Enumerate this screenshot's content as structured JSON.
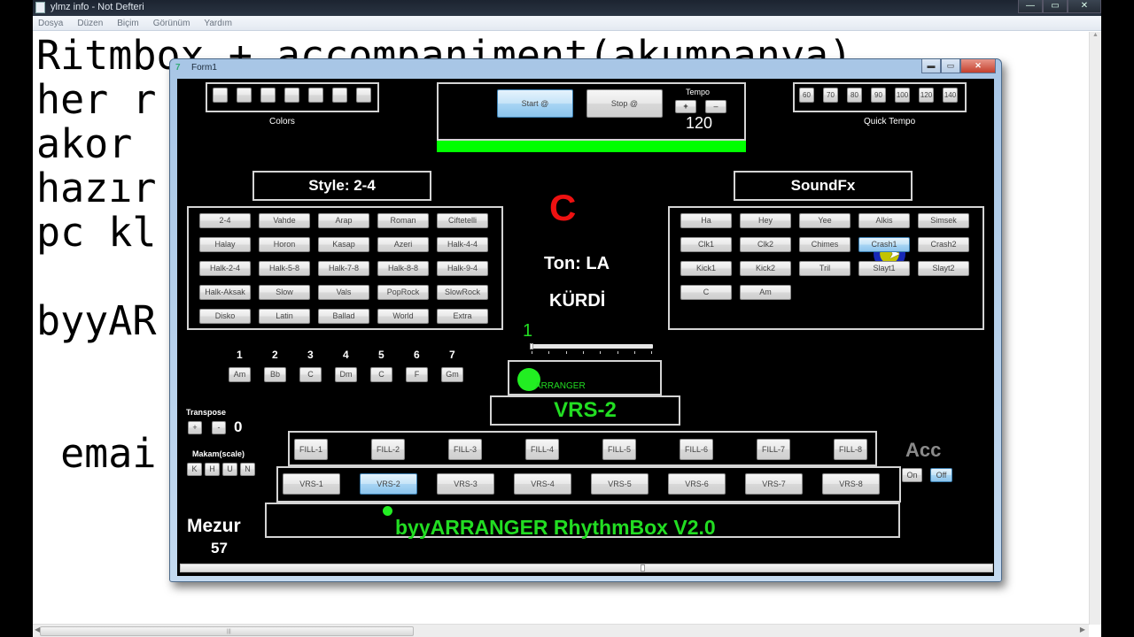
{
  "notepad": {
    "title": "ylmz info - Not Defteri",
    "menu": [
      "Dosya",
      "Düzen",
      "Biçim",
      "Görünüm",
      "Yardım"
    ],
    "text_lines": [
      "Ritmbox + accompaniment(akumpanya)",
      "her r",
      "akor",
      "hazır",
      "pc kl                            nda",
      "",
      "byyAR",
      "",
      "",
      " emai"
    ],
    "caption": {
      "minimize": "—",
      "maximize": "▭",
      "close": "✕"
    }
  },
  "form": {
    "title": "Form1",
    "caption": {
      "minimize": "▬",
      "maximize": "▭",
      "close": "✕"
    },
    "colors": {
      "label": "Colors",
      "swatch_count": 7
    },
    "transport": {
      "start_label": "Start @",
      "stop_label": "Stop @",
      "tempo_label": "Tempo",
      "tempo_plus": "+",
      "tempo_minus": "–",
      "tempo_value": "120"
    },
    "quick_tempo": {
      "label": "Quick Tempo",
      "values": [
        "60",
        "70",
        "80",
        "90",
        "100",
        "120",
        "140"
      ]
    },
    "style": {
      "title": "Style: 2-4",
      "buttons": [
        "2-4",
        "Vahde",
        "Arap",
        "Roman",
        "Ciftetelli",
        "Halay",
        "Horon",
        "Kasap",
        "Azeri",
        "Halk-4-4",
        "Halk-2-4",
        "Halk-5-8",
        "Halk-7-8",
        "Halk-8-8",
        "Halk-9-4",
        "Halk-Aksak",
        "Slow",
        "Vals",
        "PopRock",
        "SlowRock",
        "Disko",
        "Latin",
        "Ballad",
        "World",
        "Extra"
      ]
    },
    "center": {
      "chord": "C",
      "ton": "Ton: LA",
      "makam": "KÜRDİ",
      "beat": "1",
      "beat_progress": 0.0,
      "arranger_label": "ARRANGER",
      "vrs_display": "VRS-2"
    },
    "soundfx": {
      "title": "SoundFx",
      "buttons": [
        "Ha",
        "Hey",
        "Yee",
        "Alkis",
        "Simsek",
        "Clk1",
        "Clk2",
        "Chimes",
        "Crash1",
        "Crash2",
        "Kick1",
        "Kick2",
        "Tril",
        "Slayt1",
        "Slayt2",
        "C",
        "Am"
      ],
      "hovered": "Crash1"
    },
    "chords": {
      "numbers": [
        "1",
        "2",
        "3",
        "4",
        "5",
        "6",
        "7"
      ],
      "buttons": [
        "Am",
        "Bb",
        "C",
        "Dm",
        "C",
        "F",
        "Gm"
      ]
    },
    "transpose": {
      "label": "Transpose",
      "plus": "+",
      "minus": "-",
      "value": "0"
    },
    "makam_scale": {
      "label": "Makam(scale)",
      "buttons": [
        "K",
        "H",
        "U",
        "N"
      ]
    },
    "fills": [
      "FILL-1",
      "FILL-2",
      "FILL-3",
      "FILL-4",
      "FILL-5",
      "FILL-6",
      "FILL-7",
      "FILL-8"
    ],
    "variations": [
      "VRS-1",
      "VRS-2",
      "VRS-3",
      "VRS-4",
      "VRS-5",
      "VRS-6",
      "VRS-7",
      "VRS-8"
    ],
    "active_variation": "VRS-2",
    "acc": {
      "label": "Acc",
      "on": "On",
      "off": "Off",
      "state": "Off"
    },
    "mezur": {
      "label": "Mezur",
      "value": "57"
    },
    "banner": "byyARRANGER RhythmBox V2.0",
    "colors_theme": {
      "accent_green": "#22dd22",
      "chord_red": "#ee1111",
      "progress_green": "#00ff00"
    }
  }
}
